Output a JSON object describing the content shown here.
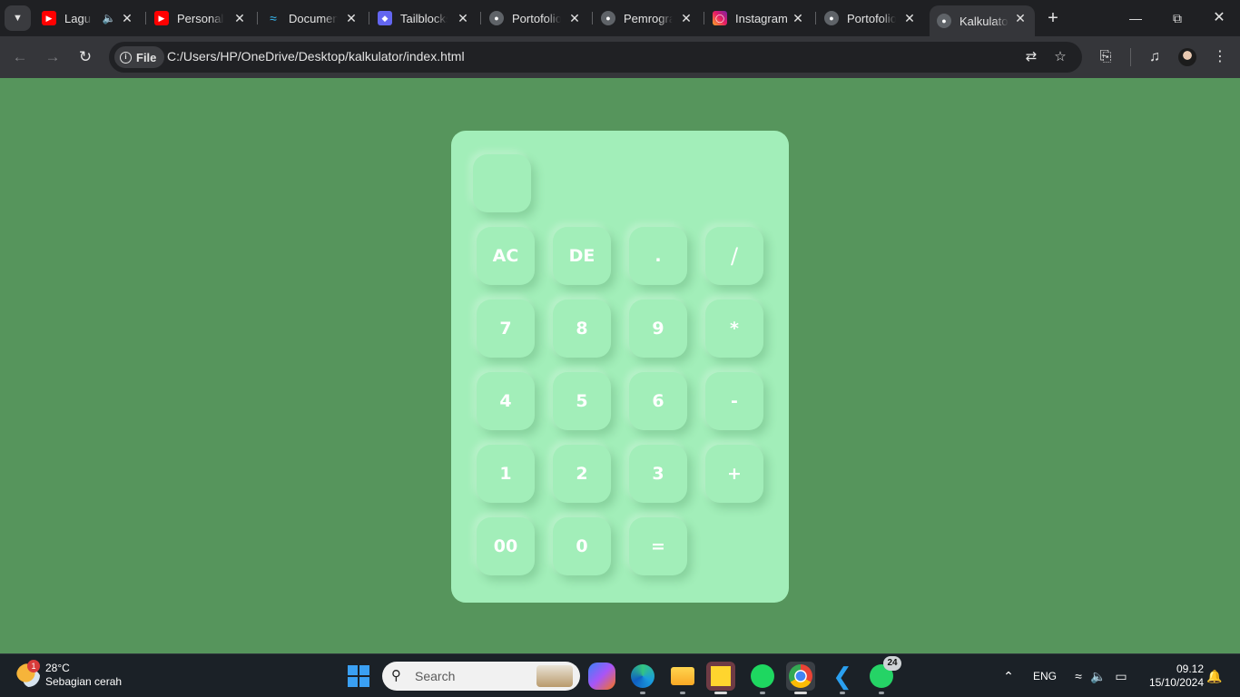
{
  "browser": {
    "tabs": [
      {
        "title": "Lagu Kenangan",
        "favicon": "youtube-icon",
        "audio": true
      },
      {
        "title": "Personal Branding",
        "favicon": "youtube-icon"
      },
      {
        "title": "Documentation",
        "favicon": "tailwind-icon"
      },
      {
        "title": "Tailblocks",
        "favicon": "tailblocks-icon"
      },
      {
        "title": "Portofolio",
        "favicon": "globe-icon"
      },
      {
        "title": "Pemrograman",
        "favicon": "globe-icon"
      },
      {
        "title": "Instagram",
        "favicon": "instagram-icon"
      },
      {
        "title": "Portofolio",
        "favicon": "globe-icon"
      },
      {
        "title": "Kalkulator",
        "favicon": "globe-icon",
        "active": true
      }
    ],
    "chip_label": "File",
    "url": "C:/Users/HP/OneDrive/Desktop/kalkulator/index.html"
  },
  "calculator": {
    "display_value": "",
    "keys": {
      "ac": "AC",
      "de": "DE",
      "dot": ".",
      "divide": "/",
      "k7": "7",
      "k8": "8",
      "k9": "9",
      "multiply": "*",
      "k4": "4",
      "k5": "5",
      "k6": "6",
      "minus": "-",
      "k1": "1",
      "k2": "2",
      "k3": "3",
      "plus": "+",
      "k00": "00",
      "k0": "0",
      "equals": "="
    },
    "colors": {
      "page_bg": "#56955c",
      "panel": "#a2eeb9",
      "key_text": "#ffffff"
    }
  },
  "taskbar": {
    "weather_temp": "28°C",
    "weather_desc": "Sebagian cerah",
    "weather_badge": "1",
    "search_placeholder": "Search",
    "whatsapp_badge": "24",
    "language": "ENG",
    "time": "09.12",
    "date": "15/10/2024"
  }
}
